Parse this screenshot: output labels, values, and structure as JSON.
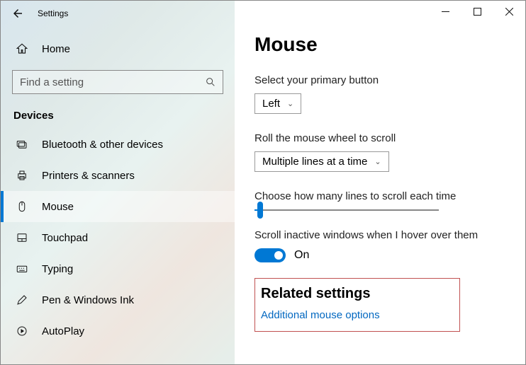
{
  "window": {
    "title": "Settings"
  },
  "sidebar": {
    "home_label": "Home",
    "search_placeholder": "Find a setting",
    "category": "Devices",
    "items": [
      {
        "label": "Bluetooth & other devices"
      },
      {
        "label": "Printers & scanners"
      },
      {
        "label": "Mouse"
      },
      {
        "label": "Touchpad"
      },
      {
        "label": "Typing"
      },
      {
        "label": "Pen & Windows Ink"
      },
      {
        "label": "AutoPlay"
      }
    ]
  },
  "page": {
    "title": "Mouse",
    "primary_button": {
      "label": "Select your primary button",
      "value": "Left"
    },
    "wheel": {
      "label": "Roll the mouse wheel to scroll",
      "value": "Multiple lines at a time"
    },
    "lines": {
      "label": "Choose how many lines to scroll each time"
    },
    "inactive": {
      "label": "Scroll inactive windows when I hover over them",
      "value": "On"
    },
    "related": {
      "title": "Related settings",
      "link": "Additional mouse options"
    }
  }
}
